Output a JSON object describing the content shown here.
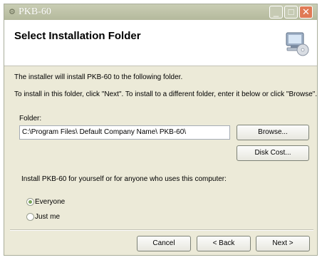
{
  "window": {
    "title": "PKB-60"
  },
  "header": {
    "title": "Select Installation Folder"
  },
  "body": {
    "intro": "The installer will install PKB-60 to the following folder.",
    "instructions": "To install in this folder, click \"Next\". To install to a different folder, enter it below or click \"Browse\".",
    "folder_label": "Folder:",
    "folder_value": "C:\\Program Files\\ Default Company Name\\ PKB-60\\",
    "browse_label": "Browse...",
    "disk_cost_label": "Disk Cost...",
    "install_for_question": "Install PKB-60 for yourself or for anyone who uses this computer:",
    "options": [
      {
        "label": "Everyone",
        "selected": true
      },
      {
        "label": "Just me",
        "selected": false
      }
    ]
  },
  "footer": {
    "cancel_label": "Cancel",
    "back_label": "< Back",
    "next_label": "Next >"
  }
}
